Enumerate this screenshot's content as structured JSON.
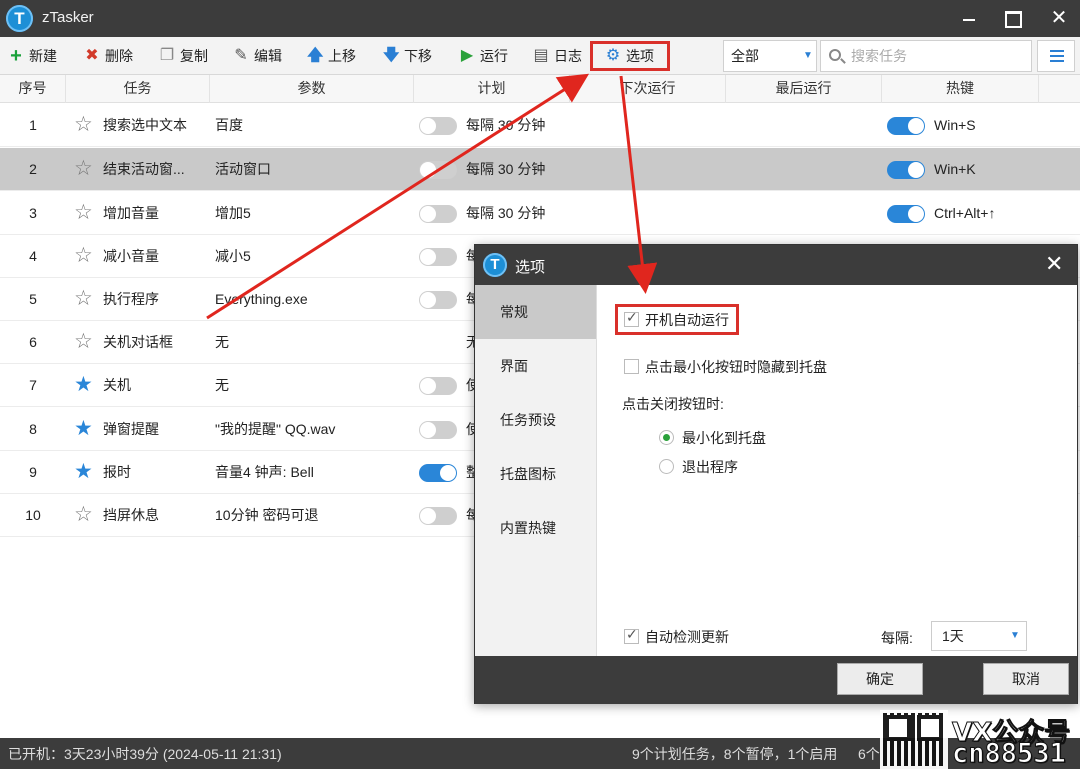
{
  "window": {
    "title": "zTasker",
    "logo_letter": "T"
  },
  "toolbar": {
    "new": "新建",
    "delete": "删除",
    "copy": "复制",
    "edit": "编辑",
    "move_up": "上移",
    "move_down": "下移",
    "run": "运行",
    "log": "日志",
    "options": "选项",
    "filter_value": "全部",
    "search_placeholder": "搜索任务"
  },
  "table": {
    "headers": {
      "no": "序号",
      "task": "任务",
      "params": "参数",
      "plan": "计划",
      "next_run": "下次运行",
      "last_run": "最后运行",
      "hotkey": "热键"
    },
    "rows": [
      {
        "no": "1",
        "name": "搜索选中文本",
        "param": "百度",
        "plan": "每隔 30 分钟",
        "hotkey": "Win+S"
      },
      {
        "no": "2",
        "name": "结束活动窗...",
        "param": "活动窗口",
        "plan": "每隔 30 分钟",
        "hotkey": "Win+K"
      },
      {
        "no": "3",
        "name": "增加音量",
        "param": "增加5",
        "plan": "每隔 30 分钟",
        "hotkey": "Ctrl+Alt+↑"
      },
      {
        "no": "4",
        "name": "减小音量",
        "param": "减小5",
        "plan": "每"
      },
      {
        "no": "5",
        "name": "执行程序",
        "param": "Everything.exe",
        "plan": "每"
      },
      {
        "no": "6",
        "name": "关机对话框",
        "param": "无",
        "plan": "无"
      },
      {
        "no": "7",
        "name": "关机",
        "param": "无",
        "plan": "使"
      },
      {
        "no": "8",
        "name": "弹窗提醒",
        "param": "\"我的提醒\" QQ.wav",
        "plan": "使"
      },
      {
        "no": "9",
        "name": "报时",
        "param": "音量4 钟声: Bell",
        "plan": "整"
      },
      {
        "no": "10",
        "name": "挡屏休息",
        "param": "10分钟 密码可退",
        "plan": "每"
      }
    ]
  },
  "status": {
    "uptime": "已开机：3天23小时39分 (2024-05-11 21:31)",
    "summary": "9个计划任务，8个暂停，1个启用",
    "more": "6个"
  },
  "dialog": {
    "title": "选项",
    "logo_letter": "T",
    "sidebar": [
      "常规",
      "界面",
      "任务预设",
      "托盘图标",
      "内置热键"
    ],
    "auto_start": "开机自动运行",
    "hide_to_tray": "点击最小化按钮时隐藏到托盘",
    "on_close_label": "点击关闭按钮时:",
    "minimize_to_tray": "最小化到托盘",
    "exit_program": "退出程序",
    "auto_update": "自动检测更新",
    "interval_label": "每隔:",
    "interval_value": "1天",
    "ok": "确定",
    "cancel": "取消"
  },
  "watermark": {
    "line1": "VX公众号",
    "line2": "cn88531"
  }
}
